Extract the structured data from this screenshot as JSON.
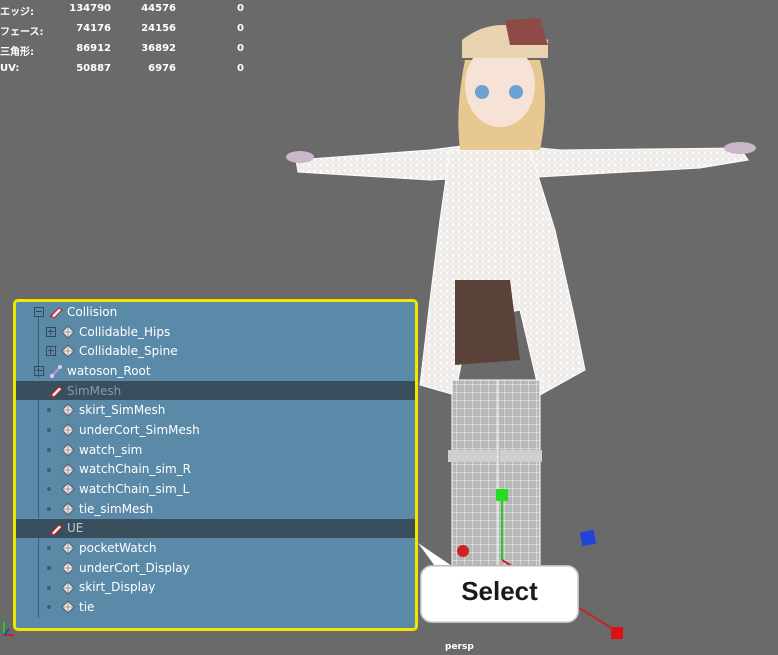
{
  "hud": {
    "rows": [
      {
        "label": "エッジ:",
        "v1": "134790",
        "v2": "44576",
        "v3": "0"
      },
      {
        "label": "フェース:",
        "v1": "74176",
        "v2": "24156",
        "v3": "0"
      },
      {
        "label": "三角形:",
        "v1": "86912",
        "v2": "36892",
        "v3": "0"
      },
      {
        "label": "UV:",
        "v1": "50887",
        "v2": "6976",
        "v3": "0"
      }
    ]
  },
  "outliner": {
    "items": [
      {
        "label": "Collision"
      },
      {
        "label": "Collidable_Hips"
      },
      {
        "label": "Collidable_Spine"
      },
      {
        "label": "watoson_Root"
      },
      {
        "label": "SimMesh"
      },
      {
        "label": "skirt_SimMesh"
      },
      {
        "label": "underCort_SimMesh"
      },
      {
        "label": "watch_sim"
      },
      {
        "label": "watchChain_sim_R"
      },
      {
        "label": "watchChain_sim_L"
      },
      {
        "label": "tie_simMesh"
      },
      {
        "label": "UE"
      },
      {
        "label": "pocketWatch"
      },
      {
        "label": "underCort_Display"
      },
      {
        "label": "skirt_Display"
      },
      {
        "label": "tie"
      }
    ]
  },
  "callout": {
    "text": "Select"
  },
  "viewport": {
    "camera": "persp"
  },
  "colors": {
    "highlight": "#f2e600",
    "outliner_bg": "#5a8aa8",
    "viewport_bg": "#6a6a6a"
  }
}
